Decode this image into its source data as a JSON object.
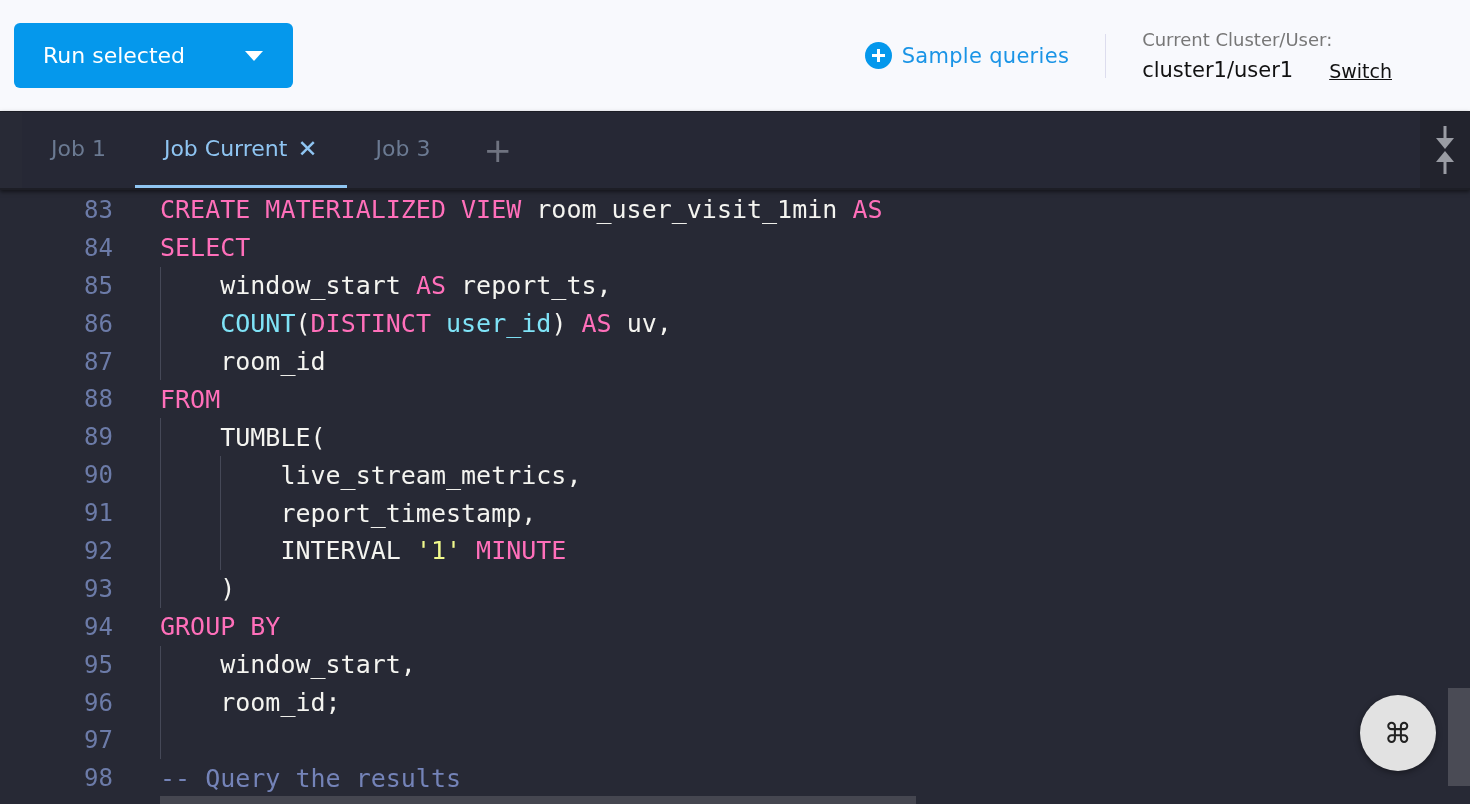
{
  "toolbar": {
    "run_button": "Run selected",
    "sample_queries": "Sample queries",
    "cluster_label": "Current Cluster/User:",
    "cluster_value": "cluster1/user1",
    "switch_link": "Switch"
  },
  "tabs": [
    {
      "label": "Job 1",
      "selected": false,
      "closable": false
    },
    {
      "label": "Job Current",
      "selected": true,
      "closable": true,
      "close_icon": "✕"
    },
    {
      "label": "Job 3",
      "selected": false,
      "closable": false
    }
  ],
  "add_tab": "+",
  "editor": {
    "lines": [
      {
        "number": "83",
        "tokens": [
          {
            "text": "CREATE MATERIALIZED VIEW",
            "kind": "keyword"
          },
          {
            "text": " room_user_visit_1min ",
            "kind": "plain"
          },
          {
            "text": "AS",
            "kind": "keyword"
          }
        ]
      },
      {
        "number": "84",
        "tokens": [
          {
            "text": "SELECT",
            "kind": "keyword"
          }
        ]
      },
      {
        "number": "85",
        "tokens": [
          {
            "text": "    window_start ",
            "kind": "plain"
          },
          {
            "text": "AS",
            "kind": "keyword"
          },
          {
            "text": " report_ts,",
            "kind": "plain"
          }
        ]
      },
      {
        "number": "86",
        "tokens": [
          {
            "text": "    COUNT",
            "kind": "function"
          },
          {
            "text": "(",
            "kind": "plain"
          },
          {
            "text": "DISTINCT",
            "kind": "keyword"
          },
          {
            "text": " user_id",
            "kind": "function"
          },
          {
            "text": ") ",
            "kind": "plain"
          },
          {
            "text": "AS",
            "kind": "keyword"
          },
          {
            "text": " uv,",
            "kind": "plain"
          }
        ]
      },
      {
        "number": "87",
        "tokens": [
          {
            "text": "    room_id",
            "kind": "plain"
          }
        ]
      },
      {
        "number": "88",
        "tokens": [
          {
            "text": "FROM",
            "kind": "keyword"
          }
        ]
      },
      {
        "number": "89",
        "tokens": [
          {
            "text": "    TUMBLE(",
            "kind": "plain"
          }
        ]
      },
      {
        "number": "90",
        "tokens": [
          {
            "text": "        live_stream_metrics,",
            "kind": "plain"
          }
        ]
      },
      {
        "number": "91",
        "tokens": [
          {
            "text": "        report_timestamp,",
            "kind": "plain"
          }
        ]
      },
      {
        "number": "92",
        "tokens": [
          {
            "text": "        INTERVAL ",
            "kind": "plain"
          },
          {
            "text": "'1'",
            "kind": "string"
          },
          {
            "text": " MINUTE",
            "kind": "keyword"
          }
        ]
      },
      {
        "number": "93",
        "tokens": [
          {
            "text": "    )",
            "kind": "plain"
          }
        ]
      },
      {
        "number": "94",
        "tokens": [
          {
            "text": "GROUP BY",
            "kind": "keyword"
          }
        ]
      },
      {
        "number": "95",
        "tokens": [
          {
            "text": "    window_start,",
            "kind": "plain"
          }
        ]
      },
      {
        "number": "96",
        "tokens": [
          {
            "text": "    room_id;",
            "kind": "plain"
          }
        ]
      },
      {
        "number": "97"
      },
      {
        "number": "98",
        "tokens": [
          {
            "text": "-- Query the results",
            "kind": "comment"
          }
        ]
      }
    ]
  },
  "shortcut_button": "⌘"
}
